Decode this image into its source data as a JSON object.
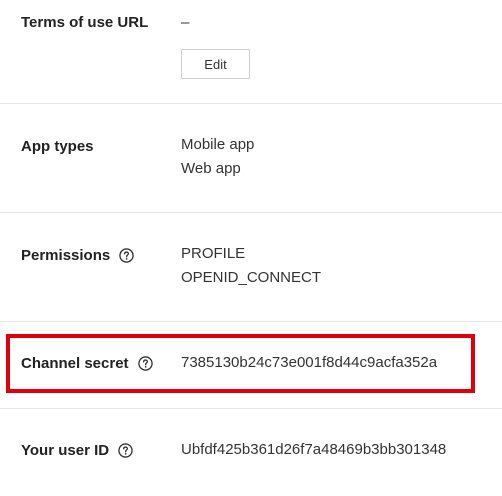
{
  "terms_of_use": {
    "label": "Terms of use URL",
    "value": "–",
    "edit_label": "Edit"
  },
  "app_types": {
    "label": "App types",
    "values": [
      "Mobile app",
      "Web app"
    ]
  },
  "permissions": {
    "label": "Permissions",
    "values": [
      "PROFILE",
      "OPENID_CONNECT"
    ],
    "help_icon": "question-circle-icon"
  },
  "channel_secret": {
    "label": "Channel secret",
    "value": "7385130b24c73e001f8d44c9acfa352a",
    "help_icon": "question-circle-icon",
    "highlight_color": "#e0000b"
  },
  "user_id": {
    "label": "Your user ID",
    "value": "Ubfdf425b361d26f7a48469b3bb301348",
    "help_icon": "question-circle-icon"
  }
}
